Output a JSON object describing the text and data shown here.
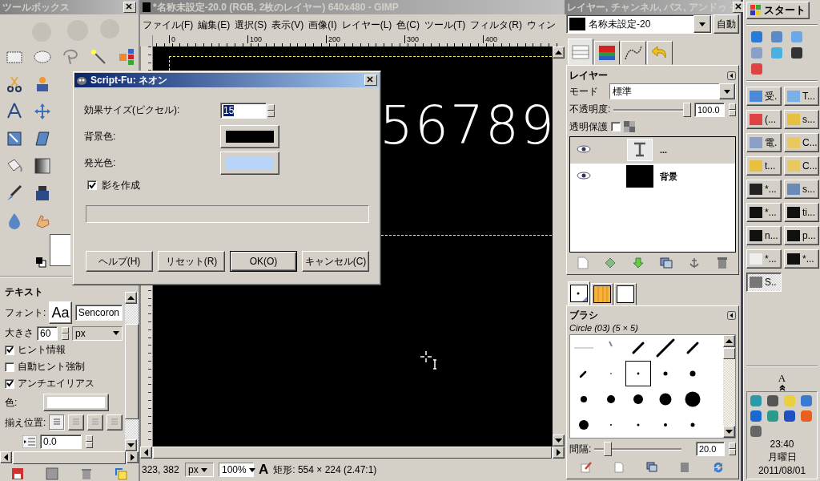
{
  "toolbox": {
    "title": "ツールボックス",
    "options_title": "テキスト",
    "font_label": "フォント:",
    "font_preview": "Aa",
    "font_value": "Sencoron",
    "size_label": "大きさ",
    "size_value": "60",
    "unit": "px",
    "checkboxes": [
      {
        "label": "ヒント情報",
        "checked": true
      },
      {
        "label": "自動ヒント強制",
        "checked": false
      },
      {
        "label": "アンチエイリアス",
        "checked": true
      }
    ],
    "color_label": "色:",
    "justify_label": "揃え位置:",
    "justify": [
      {
        "selected": true
      },
      {
        "selected": false
      },
      {
        "selected": false
      },
      {
        "selected": false
      }
    ],
    "indent_value": "0.0"
  },
  "image_window": {
    "title": "*名称未設定-20.0 (RGB, 2枚のレイヤー) 640x480 - GIMP",
    "menu": [
      "ファイル(F)",
      "編集(E)",
      "選択(S)",
      "表示(V)",
      "画像(I)",
      "レイヤー(L)",
      "色(C)",
      "ツール(T)",
      "フィルタ(R)",
      "ウィン"
    ],
    "ruler": [
      "0",
      "100",
      "200",
      "300",
      "400"
    ],
    "canvas_text": "56789",
    "status": {
      "coords": "323, 382",
      "unit": "px",
      "zoom": "100%",
      "glyph": "A",
      "message": "矩形: 554 × 224 (2.47:1)"
    }
  },
  "dialog": {
    "title": "Script-Fu: ネオン",
    "fields": [
      {
        "kind": "spin",
        "label": "効果サイズ(ピクセル):",
        "value": "15"
      },
      {
        "kind": "color",
        "label": "背景色:",
        "color": "#000000"
      },
      {
        "kind": "color",
        "label": "発光色:",
        "color": "#b8d4f8"
      }
    ],
    "shadow": {
      "label": "影を作成",
      "checked": true
    },
    "progress": {
      "level": 0
    },
    "buttons": [
      {
        "label": "ヘルプ(H)",
        "default": false
      },
      {
        "label": "リセット(R)",
        "default": false
      },
      {
        "label": "OK(O)",
        "default": true
      },
      {
        "label": "キャンセル(C)",
        "default": false
      }
    ]
  },
  "dock": {
    "title": "レイヤー, チャンネル, パス, アンドゥ -",
    "image": "名称未設定-20",
    "auto": "自動",
    "tabs": [
      {
        "selected": true
      },
      {
        "selected": false
      },
      {
        "selected": false
      },
      {
        "selected": false
      }
    ],
    "layers_title": "レイヤー",
    "mode_label": "モード",
    "mode": "標準",
    "opacity_label": "不透明度:",
    "opacity": {
      "level": 1,
      "value": "100.0"
    },
    "lock_label": "透明保護",
    "lock": false,
    "layers": [
      {
        "kind": "text",
        "name": "...",
        "selected": true,
        "visible": true
      },
      {
        "kind": "fill",
        "name": "背景",
        "selected": false,
        "visible": true
      }
    ],
    "brush_tabs": [
      {
        "selected": true
      },
      {
        "selected": false
      },
      {
        "selected": false
      }
    ],
    "brushes_title": "ブラシ",
    "brush_name": "Circle (03) (5 × 5)",
    "brushes": [
      {
        "selected": false
      },
      {
        "selected": false
      },
      {
        "selected": false
      },
      {
        "selected": false
      },
      {
        "selected": false
      },
      {
        "selected": false
      },
      {
        "selected": false
      },
      {
        "selected": true
      },
      {
        "selected": false
      },
      {
        "selected": false
      },
      {
        "selected": false
      },
      {
        "selected": false
      },
      {
        "selected": false
      },
      {
        "selected": false
      },
      {
        "selected": false
      },
      {
        "selected": false
      },
      {
        "selected": false
      },
      {
        "selected": false
      },
      {
        "selected": false
      },
      {
        "selected": false
      }
    ],
    "spacing_label": "間隔:",
    "spacing": {
      "level": 0.12,
      "value": "20.0"
    }
  },
  "taskbar": {
    "start": "スタート",
    "tasks": [
      {
        "label": "受.",
        "selected": false
      },
      {
        "label": "T...",
        "selected": false
      },
      {
        "label": "(...",
        "selected": false
      },
      {
        "label": "s...",
        "selected": false
      },
      {
        "label": "電.",
        "selected": false
      },
      {
        "label": "C...",
        "selected": false
      },
      {
        "label": "t...",
        "selected": false
      },
      {
        "label": "C...",
        "selected": false
      },
      {
        "label": "*...",
        "selected": false
      },
      {
        "label": "s...",
        "selected": false
      },
      {
        "label": "*...",
        "selected": false
      },
      {
        "label": "ti...",
        "selected": false
      },
      {
        "label": "n...",
        "selected": false
      },
      {
        "label": "p...",
        "selected": false
      },
      {
        "label": "*...",
        "selected": false
      },
      {
        "label": "*...",
        "selected": false
      },
      {
        "label": "S..",
        "selected": true
      }
    ],
    "lang": "A",
    "clock": {
      "time": "23:40",
      "day": "月曜日",
      "date": "2011/08/01"
    }
  }
}
